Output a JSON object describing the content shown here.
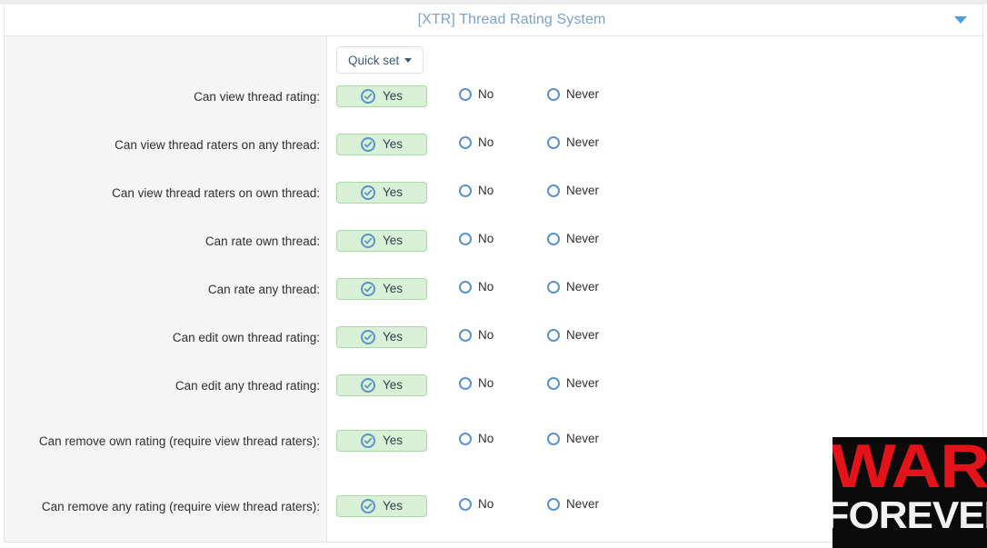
{
  "block": {
    "title": "[XTR] Thread Rating System",
    "collapse_icon": "chevron-down-icon"
  },
  "toolbar": {
    "quick_set_label": "Quick set",
    "quick_set_caret": "caret-down-icon"
  },
  "choices": {
    "yes": "Yes",
    "no": "No",
    "never": "Never"
  },
  "colors": {
    "title": "#7ca2c4",
    "selected_bg": "#d8f0d6",
    "selected_border": "#a9d9a5",
    "radio_blue": "#5b92c9",
    "label_col_bg": "#f5f5f6",
    "watermark_bg": "#0b0b0b",
    "watermark_war": "#e41319",
    "watermark_forever": "#f2f2f2"
  },
  "permissions": [
    {
      "label": "Can view thread rating:",
      "selected": "yes"
    },
    {
      "label": "Can view thread raters on any thread:",
      "selected": "yes"
    },
    {
      "label": "Can view thread raters on own thread:",
      "selected": "yes"
    },
    {
      "label": "Can rate own thread:",
      "selected": "yes"
    },
    {
      "label": "Can rate any thread:",
      "selected": "yes"
    },
    {
      "label": "Can edit own thread rating:",
      "selected": "yes"
    },
    {
      "label": "Can edit any thread rating:",
      "selected": "yes"
    },
    {
      "label": "Can remove own rating (require view thread raters):",
      "selected": "yes"
    },
    {
      "label": "Can remove any rating (require view thread raters):",
      "selected": "yes"
    }
  ],
  "watermark": {
    "line1": "WAR",
    "line2": "FOREVER"
  }
}
